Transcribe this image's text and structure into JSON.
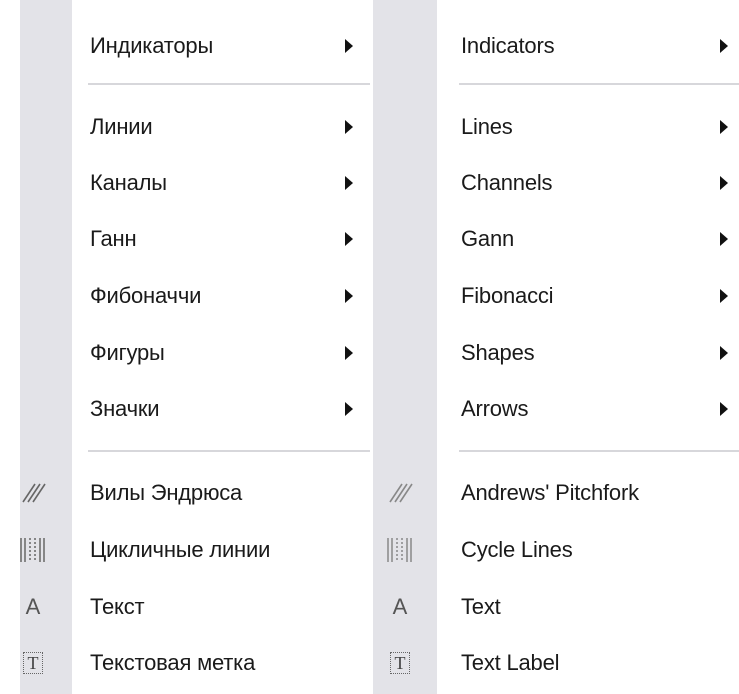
{
  "menu_ru": {
    "items": [
      {
        "label": "Индикаторы",
        "icon": "",
        "submenu": true
      },
      {
        "label": "Линии",
        "icon": "",
        "submenu": true
      },
      {
        "label": "Каналы",
        "icon": "",
        "submenu": true
      },
      {
        "label": "Ганн",
        "icon": "",
        "submenu": true
      },
      {
        "label": "Фибоначчи",
        "icon": "",
        "submenu": true
      },
      {
        "label": "Фигуры",
        "icon": "",
        "submenu": true
      },
      {
        "label": "Значки",
        "icon": "",
        "submenu": true
      },
      {
        "label": "Вилы Эндрюса",
        "icon": "pitchfork-icon",
        "submenu": false
      },
      {
        "label": "Цикличные линии",
        "icon": "cycle-lines-icon",
        "submenu": false
      },
      {
        "label": "Текст",
        "icon": "text-icon",
        "submenu": false
      },
      {
        "label": "Текстовая метка",
        "icon": "text-label-icon",
        "submenu": false
      }
    ]
  },
  "menu_en": {
    "items": [
      {
        "label": "Indicators",
        "icon": "",
        "submenu": true
      },
      {
        "label": "Lines",
        "icon": "",
        "submenu": true
      },
      {
        "label": "Channels",
        "icon": "",
        "submenu": true
      },
      {
        "label": "Gann",
        "icon": "",
        "submenu": true
      },
      {
        "label": "Fibonacci",
        "icon": "",
        "submenu": true
      },
      {
        "label": "Shapes",
        "icon": "",
        "submenu": true
      },
      {
        "label": "Arrows",
        "icon": "",
        "submenu": true
      },
      {
        "label": "Andrews' Pitchfork",
        "icon": "pitchfork-icon",
        "submenu": false
      },
      {
        "label": "Cycle Lines",
        "icon": "cycle-lines-icon",
        "submenu": false
      },
      {
        "label": "Text",
        "icon": "text-icon",
        "submenu": false
      },
      {
        "label": "Text Label",
        "icon": "text-label-icon",
        "submenu": false
      }
    ]
  },
  "icons": {
    "text_glyph": "A",
    "text_label_glyph": "T"
  },
  "colors": {
    "gutter": "#e3e3e8",
    "separator": "#d7d7db",
    "text": "#1a1a1a"
  }
}
